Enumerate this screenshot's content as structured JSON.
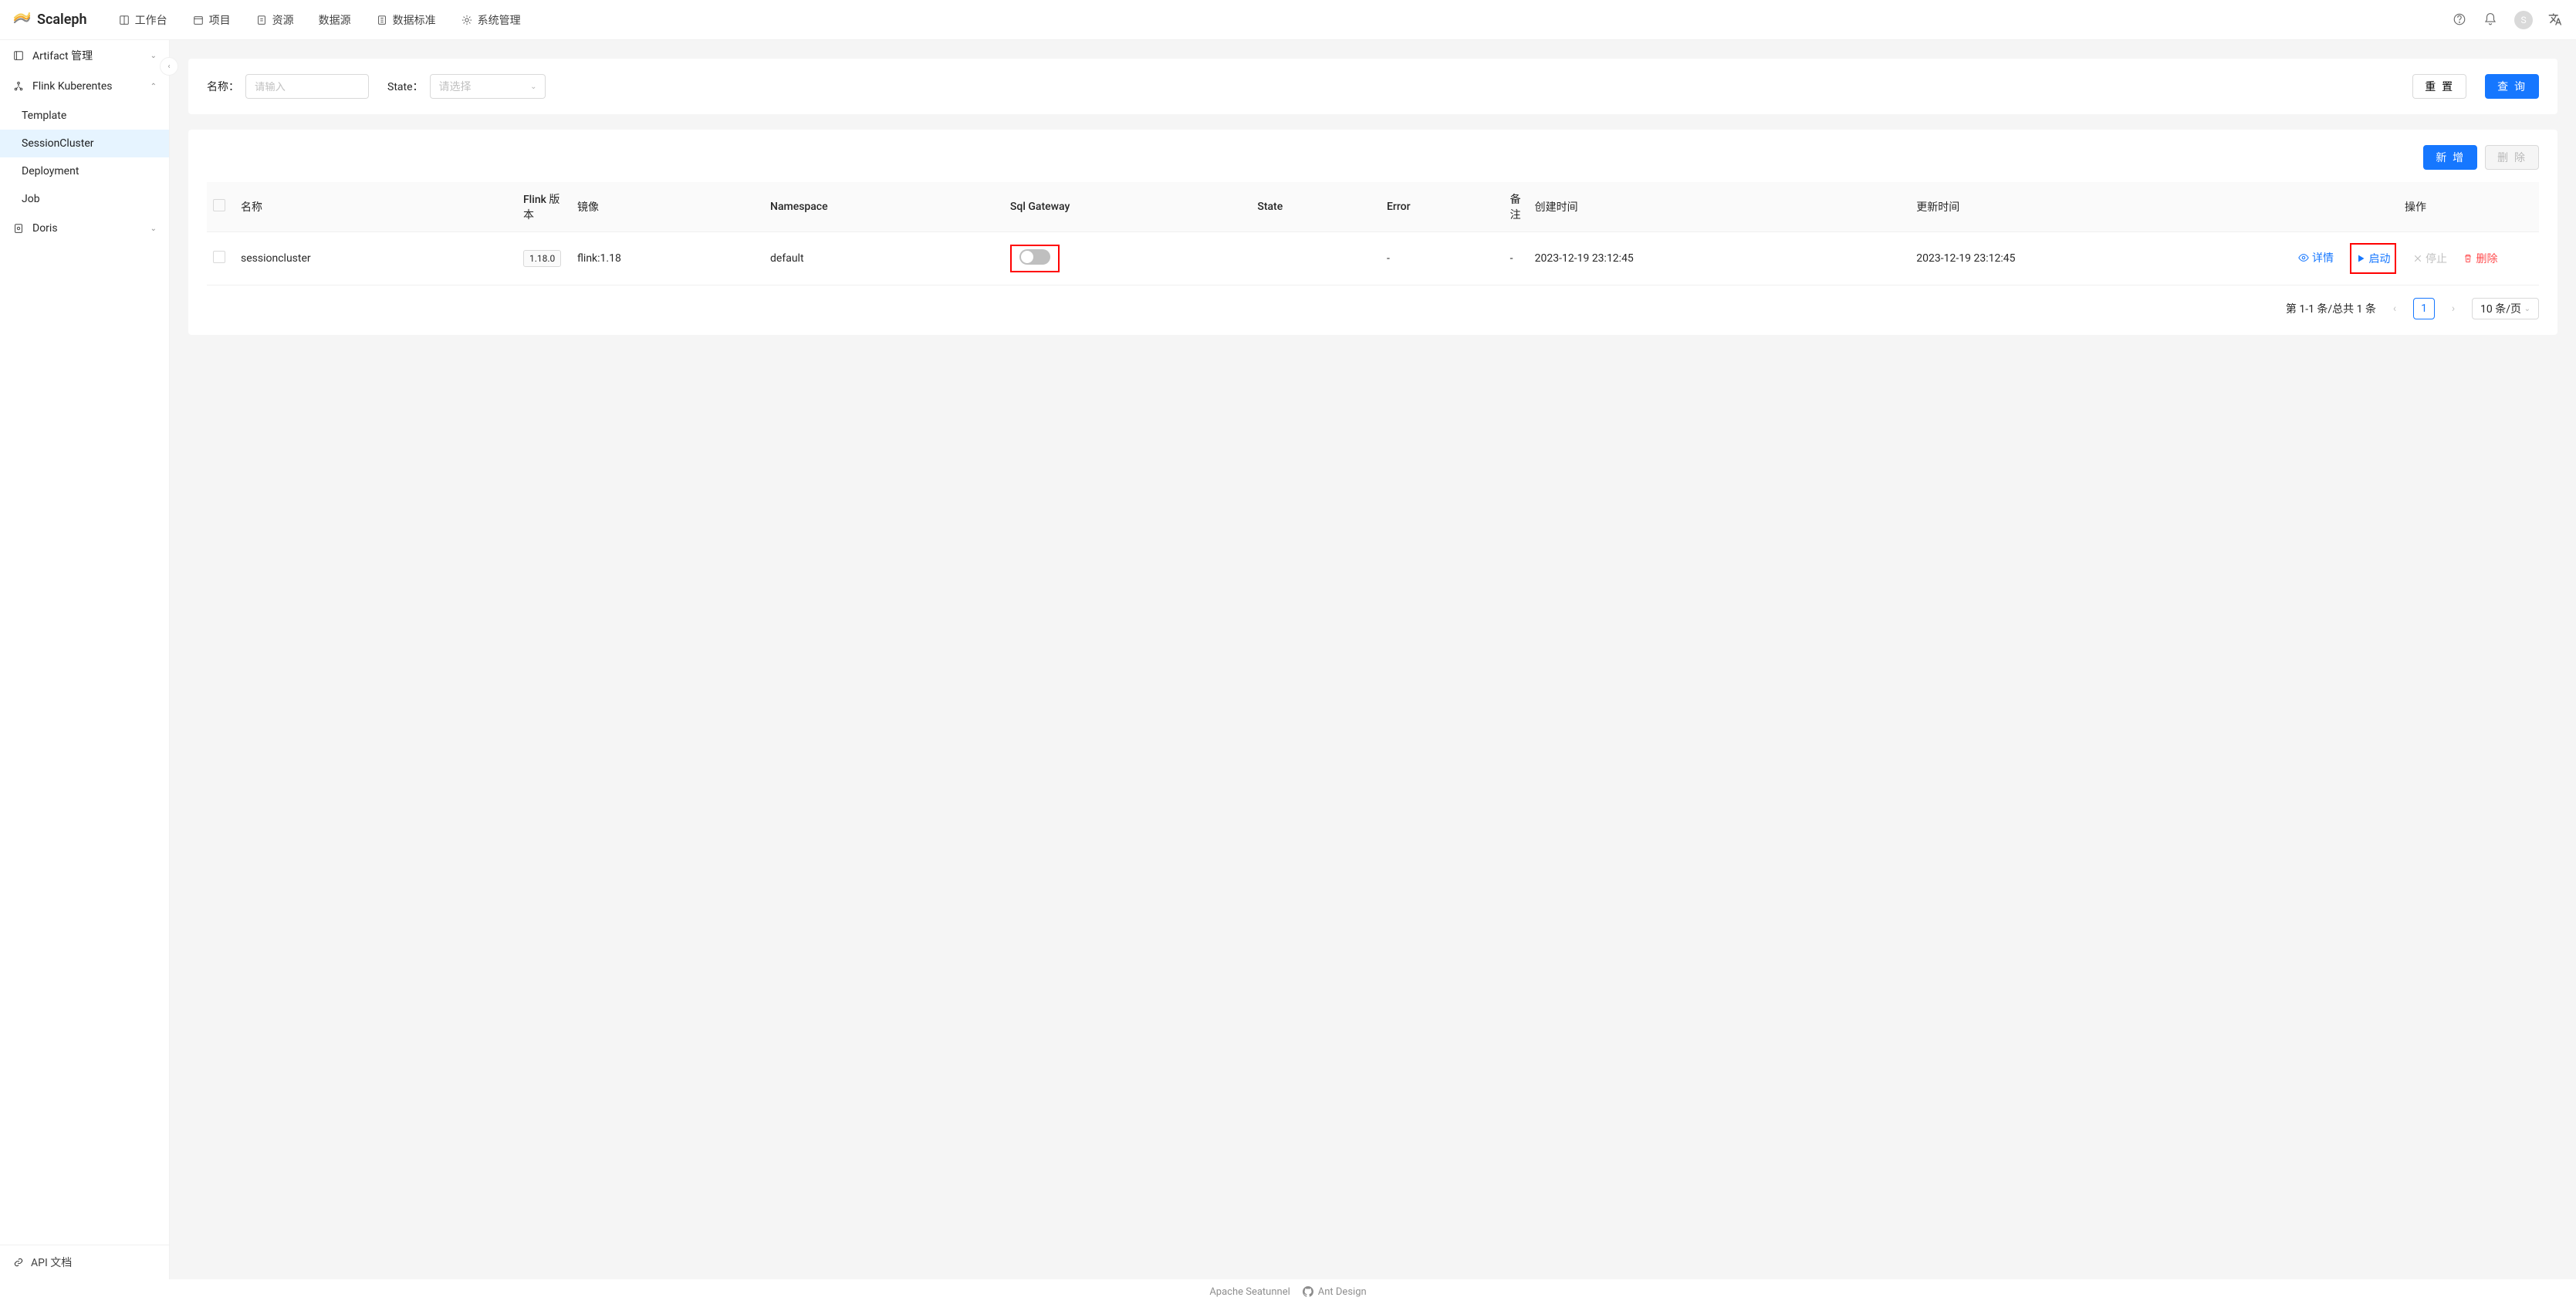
{
  "app": {
    "name": "Scaleph"
  },
  "nav": {
    "workbench": "工作台",
    "project": "项目",
    "resource": "资源",
    "datasource": "数据源",
    "datastandard": "数据标准",
    "sysadmin": "系统管理"
  },
  "header": {
    "avatar_letter": "S"
  },
  "sidebar": {
    "artifact_mgmt": "Artifact 管理",
    "flink_k8s": "Flink Kuberentes",
    "flink_items": {
      "template": "Template",
      "session_cluster": "SessionCluster",
      "deployment": "Deployment",
      "job": "Job"
    },
    "doris": "Doris",
    "api_doc": "API 文档"
  },
  "search": {
    "name_label": "名称：",
    "name_placeholder": "请输入",
    "state_label": "State：",
    "state_placeholder": "请选择",
    "reset": "重 置",
    "query": "查 询"
  },
  "toolbar": {
    "add": "新 增",
    "delete": "删 除"
  },
  "table": {
    "headers": {
      "name": "名称",
      "flink_version": "Flink 版本",
      "image": "镜像",
      "namespace": "Namespace",
      "sql_gateway": "Sql Gateway",
      "state": "State",
      "error": "Error",
      "remark": "备注",
      "create_time": "创建时间",
      "update_time": "更新时间",
      "actions": "操作"
    },
    "row": {
      "name": "sessioncluster",
      "version_tag": "1.18.0",
      "image": "flink:1.18",
      "namespace": "default",
      "error": "-",
      "remark": "-",
      "create_time": "2023-12-19 23:12:45",
      "update_time": "2023-12-19 23:12:45"
    },
    "actions": {
      "detail": "详情",
      "start": "启动",
      "stop": "停止",
      "delete": "删除"
    }
  },
  "pagination": {
    "summary": "第 1-1 条/总共 1 条",
    "page": "1",
    "page_size": "10 条/页"
  },
  "footer": {
    "seatunnel": "Apache Seatunnel",
    "antd": "Ant Design"
  }
}
